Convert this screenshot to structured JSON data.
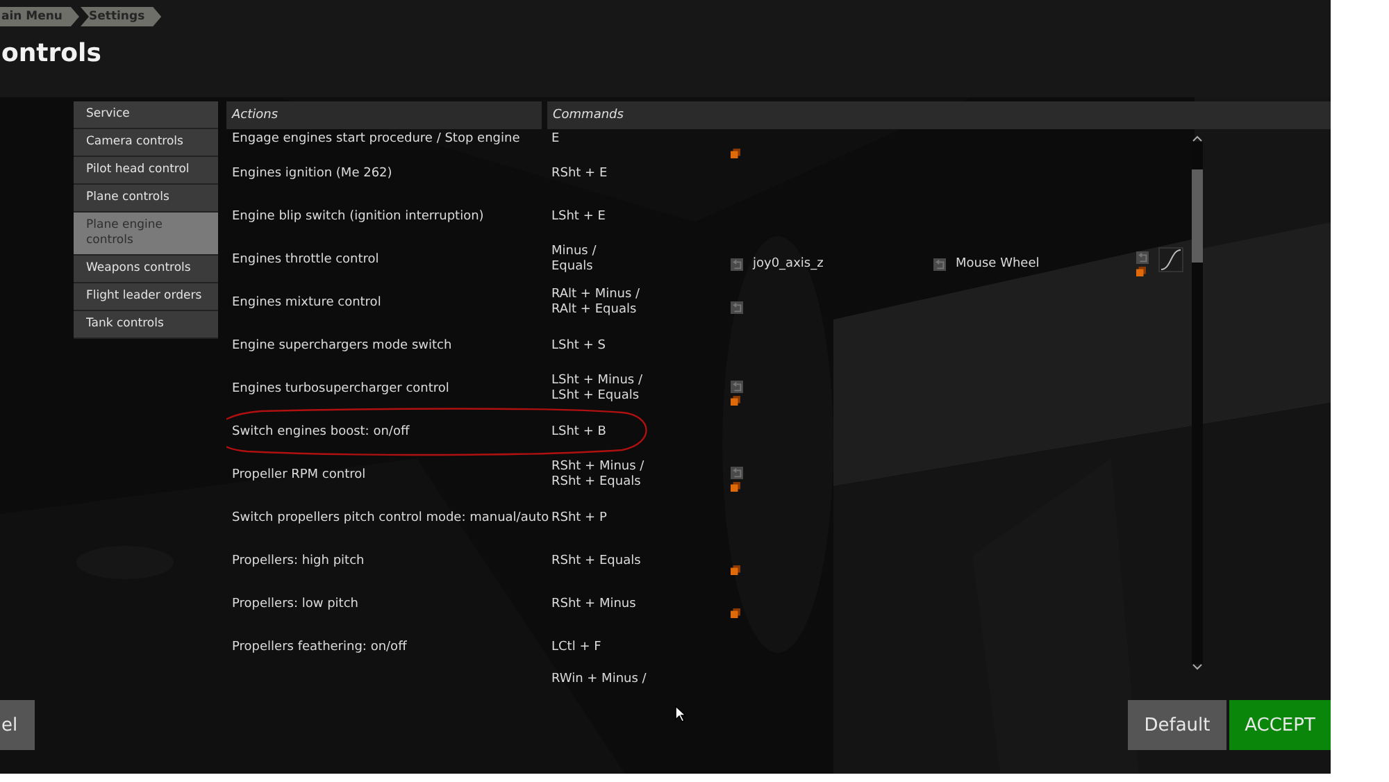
{
  "breadcrumb": [
    {
      "label": "ain Menu"
    },
    {
      "label": "Settings"
    }
  ],
  "title": "ontrols",
  "sidebar": {
    "items": [
      {
        "label": "Service",
        "selected": false
      },
      {
        "label": "Camera controls",
        "selected": false
      },
      {
        "label": "Pilot head control",
        "selected": false
      },
      {
        "label": "Plane controls",
        "selected": false
      },
      {
        "label": "Plane engine controls",
        "selected": true
      },
      {
        "label": "Weapons controls",
        "selected": false
      },
      {
        "label": "Flight leader orders",
        "selected": false
      },
      {
        "label": "Tank controls",
        "selected": false
      }
    ]
  },
  "table": {
    "columns": [
      "Actions",
      "Commands"
    ],
    "rows": [
      {
        "action": "Engage engines start procedure / Stop engine",
        "command": "E",
        "slots": [
          {
            "reset": false,
            "modified": true
          }
        ]
      },
      {
        "action": "Engines ignition (Me 262)",
        "command": "RSht + E"
      },
      {
        "action": "Engine blip switch (ignition interruption)",
        "command": "LSht + E"
      },
      {
        "action": "Engines throttle control",
        "command": "Minus /\nEquals",
        "slots": [
          {
            "reset": true,
            "modified": false,
            "device": "joy0_axis_z"
          },
          {
            "reset": true,
            "modified": false,
            "device": "Mouse Wheel"
          },
          {
            "reset": true,
            "modified": true
          }
        ],
        "curve": true
      },
      {
        "action": "Engines mixture control",
        "command": "RAlt + Minus /\nRAlt + Equals",
        "slots": [
          {
            "reset": true,
            "modified": false
          }
        ]
      },
      {
        "action": "Engine superchargers mode switch",
        "command": "LSht + S"
      },
      {
        "action": "Engines turbosupercharger control",
        "command": "LSht + Minus /\nLSht + Equals",
        "slots": [
          {
            "reset": true,
            "modified": true
          }
        ]
      },
      {
        "action": "Switch engines boost: on/off",
        "command": "LSht + B",
        "highlighted": true
      },
      {
        "action": "Propeller RPM control",
        "command": "RSht + Minus /\nRSht + Equals",
        "slots": [
          {
            "reset": true,
            "modified": true
          }
        ]
      },
      {
        "action": "Switch propellers pitch control mode: manual/auto",
        "command": "RSht + P"
      },
      {
        "action": "Propellers: high pitch",
        "command": "RSht + Equals",
        "slots": [
          {
            "reset": false,
            "modified": true
          }
        ]
      },
      {
        "action": "Propellers: low pitch",
        "command": "RSht + Minus",
        "slots": [
          {
            "reset": false,
            "modified": true
          }
        ]
      },
      {
        "action": "Propellers feathering: on/off",
        "command": "LCtl + F"
      },
      {
        "command": "RWin + Minus /"
      }
    ]
  },
  "buttons": [
    {
      "label": "el",
      "kind": "cancel"
    },
    {
      "label": "Default",
      "kind": "default"
    },
    {
      "label": "ACCEPT",
      "kind": "accept"
    }
  ]
}
